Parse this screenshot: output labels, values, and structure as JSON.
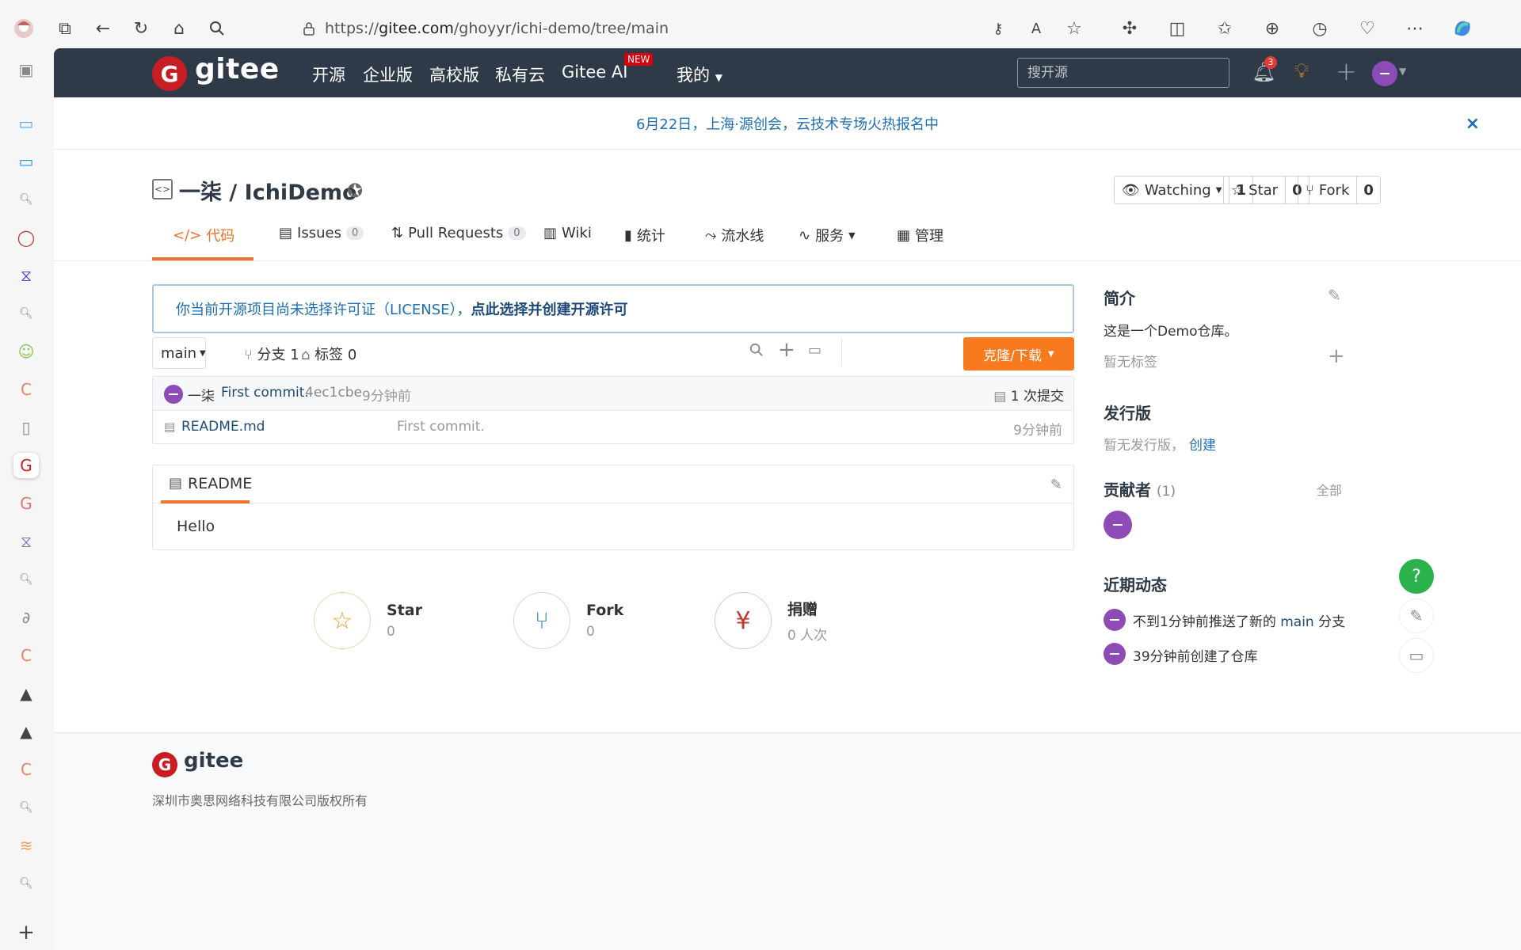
{
  "browser": {
    "url_scheme": "https://",
    "url_host": "gitee.com",
    "url_path": "/ghoyyr/ichi-demo/tree/main",
    "notification_count": "3"
  },
  "nav": {
    "logo_letter": "G",
    "logo_text": "gitee",
    "items": [
      "开源",
      "企业版",
      "高校版",
      "私有云",
      "Gitee AI",
      "我的"
    ],
    "new_badge": "NEW",
    "search_placeholder": "搜开源",
    "notif_count": "3"
  },
  "banner": {
    "text": "6月22日，上海·源创会，云技术专场火热报名中",
    "close": "×"
  },
  "repo": {
    "title": "一柒 / IchiDemo",
    "watching_label": "Watching",
    "watching_count": "1",
    "star_label": "Star",
    "star_count": "0",
    "fork_label": "Fork",
    "fork_count": "0"
  },
  "tabs": {
    "code": "代码",
    "issues": "Issues",
    "issues_count": "0",
    "pulls": "Pull Requests",
    "pulls_count": "0",
    "wiki": "Wiki",
    "stats": "统计",
    "pipeline": "流水线",
    "services": "服务",
    "manage": "管理"
  },
  "license_notice": {
    "text": "你当前开源项目尚未选择许可证（LICENSE），",
    "link": "点此选择并创建开源许可"
  },
  "toolbar": {
    "branch": "main",
    "branches": "分支 1",
    "tags": "标签 0",
    "clone": "克隆/下载"
  },
  "commit": {
    "author": "一柒",
    "message": "First commit.",
    "hash": "4ec1cbe",
    "time": "9分钟前",
    "count": "1 次提交"
  },
  "files": [
    {
      "name": "README.md",
      "message": "First commit.",
      "time": "9分钟前"
    }
  ],
  "readme": {
    "tab": "README",
    "content": "Hello"
  },
  "cards": {
    "star_label": "Star",
    "star_value": "0",
    "fork_label": "Fork",
    "fork_value": "0",
    "donate_label": "捐赠",
    "donate_value": "0 人次"
  },
  "sidebar": {
    "intro_title": "简介",
    "intro_text": "这是一个Demo仓库。",
    "no_tags": "暂无标签",
    "release_title": "发行版",
    "no_release": "暂无发行版，",
    "create": "创建",
    "contrib_title": "贡献者",
    "contrib_count": "(1)",
    "all": "全部",
    "activity_title": "近期动态",
    "activity_1_pre": "不到1分钟前推送了新的 ",
    "activity_1_branch": "main",
    "activity_1_post": " 分支",
    "activity_2": "39分钟前创建了仓库"
  },
  "footer": {
    "logo_text": "gitee",
    "copyright": "深圳市奥思网络科技有限公司版权所有"
  },
  "colors": {
    "nav_bg": "#2e3a47",
    "accent": "#f0702c",
    "brand_red": "#c71d23",
    "link": "#1e6fb3",
    "avatar": "#8d4bb8",
    "help": "#2bb24c"
  }
}
